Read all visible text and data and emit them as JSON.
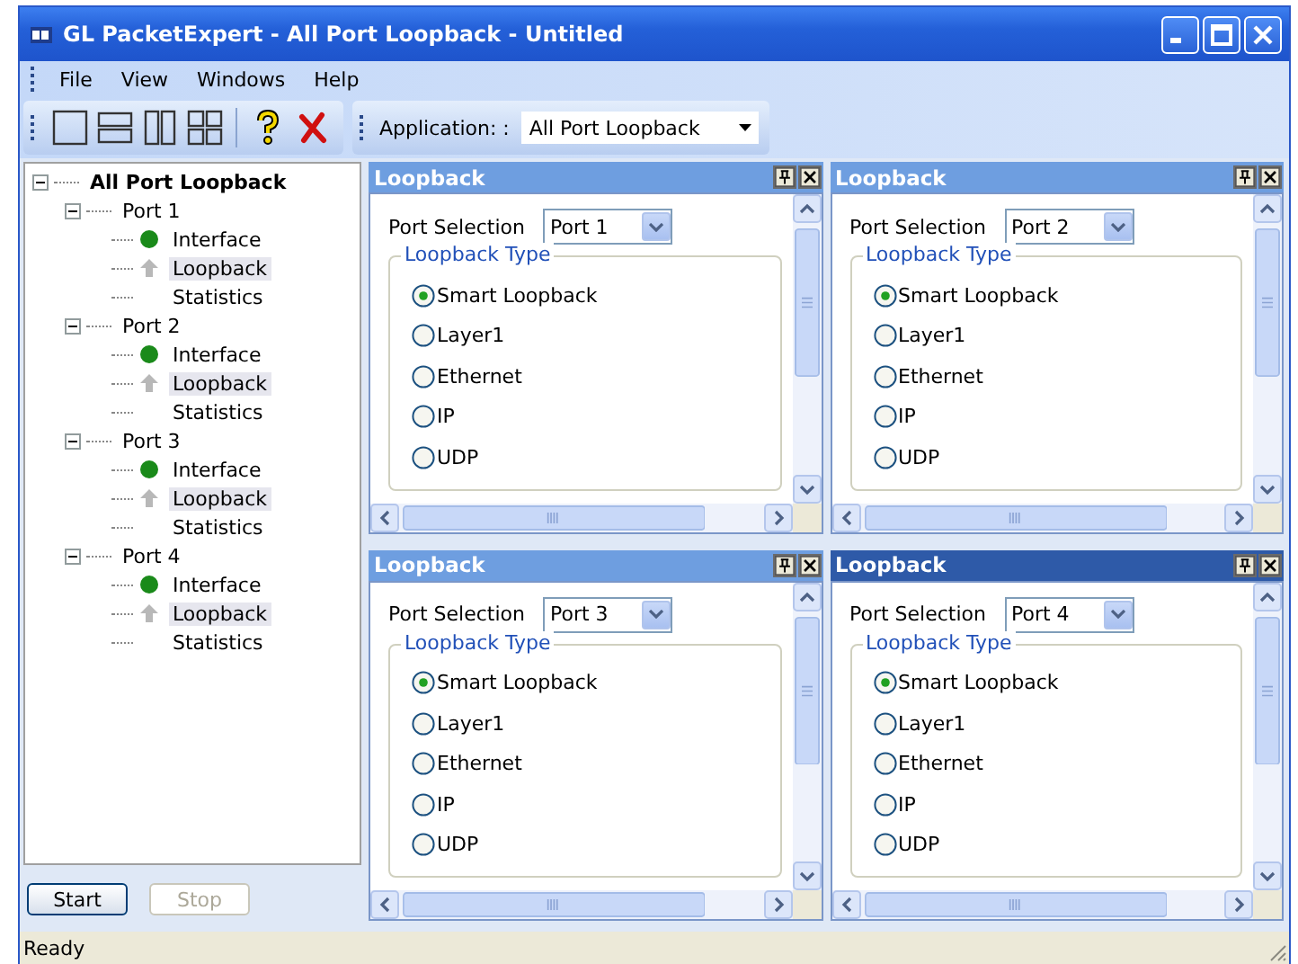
{
  "window": {
    "title": "GL PacketExpert - All Port Loopback - Untitled"
  },
  "menu": [
    "File",
    "View",
    "Windows",
    "Help"
  ],
  "toolbar": {
    "application_label": "Application: :",
    "application_value": "All Port Loopback"
  },
  "tree": {
    "label": "All Port Loopback",
    "expanded": true,
    "children": [
      {
        "label": "Port 1",
        "expanded": true,
        "children": [
          {
            "label": "Interface",
            "kind": "interface",
            "selected": false
          },
          {
            "label": "Loopback",
            "kind": "loopback",
            "selected": true
          },
          {
            "label": "Statistics",
            "kind": "statistics",
            "selected": false
          }
        ]
      },
      {
        "label": "Port 2",
        "expanded": true,
        "children": [
          {
            "label": "Interface",
            "kind": "interface",
            "selected": false
          },
          {
            "label": "Loopback",
            "kind": "loopback",
            "selected": true
          },
          {
            "label": "Statistics",
            "kind": "statistics",
            "selected": false
          }
        ]
      },
      {
        "label": "Port 3",
        "expanded": true,
        "children": [
          {
            "label": "Interface",
            "kind": "interface",
            "selected": false
          },
          {
            "label": "Loopback",
            "kind": "loopback",
            "selected": true
          },
          {
            "label": "Statistics",
            "kind": "statistics",
            "selected": false
          }
        ]
      },
      {
        "label": "Port 4",
        "expanded": true,
        "children": [
          {
            "label": "Interface",
            "kind": "interface",
            "selected": false
          },
          {
            "label": "Loopback",
            "kind": "loopback",
            "selected": true
          },
          {
            "label": "Statistics",
            "kind": "statistics",
            "selected": false
          }
        ]
      }
    ]
  },
  "buttons": [
    {
      "label": "Start",
      "disabled": false
    },
    {
      "label": "Stop",
      "disabled": true
    }
  ],
  "panes": [
    {
      "title": "Loopback",
      "active": false,
      "port_label": "Port Selection",
      "port_value": "Port 1",
      "group_title": "Loopback Type",
      "options": [
        {
          "label": "Smart Loopback",
          "selected": true
        },
        {
          "label": "Layer1",
          "selected": false
        },
        {
          "label": "Ethernet",
          "selected": false
        },
        {
          "label": "IP",
          "selected": false
        },
        {
          "label": "UDP",
          "selected": false
        }
      ]
    },
    {
      "title": "Loopback",
      "active": false,
      "port_label": "Port Selection",
      "port_value": "Port 2",
      "group_title": "Loopback Type",
      "options": [
        {
          "label": "Smart Loopback",
          "selected": true
        },
        {
          "label": "Layer1",
          "selected": false
        },
        {
          "label": "Ethernet",
          "selected": false
        },
        {
          "label": "IP",
          "selected": false
        },
        {
          "label": "UDP",
          "selected": false
        }
      ]
    },
    {
      "title": "Loopback",
      "active": false,
      "port_label": "Port Selection",
      "port_value": "Port 3",
      "group_title": "Loopback Type",
      "options": [
        {
          "label": "Smart Loopback",
          "selected": true
        },
        {
          "label": "Layer1",
          "selected": false
        },
        {
          "label": "Ethernet",
          "selected": false
        },
        {
          "label": "IP",
          "selected": false
        },
        {
          "label": "UDP",
          "selected": false
        }
      ]
    },
    {
      "title": "Loopback",
      "active": true,
      "port_label": "Port Selection",
      "port_value": "Port 4",
      "group_title": "Loopback Type",
      "options": [
        {
          "label": "Smart Loopback",
          "selected": true
        },
        {
          "label": "Layer1",
          "selected": false
        },
        {
          "label": "Ethernet",
          "selected": false
        },
        {
          "label": "IP",
          "selected": false
        },
        {
          "label": "UDP",
          "selected": false
        }
      ]
    }
  ],
  "status_bar": "Ready"
}
